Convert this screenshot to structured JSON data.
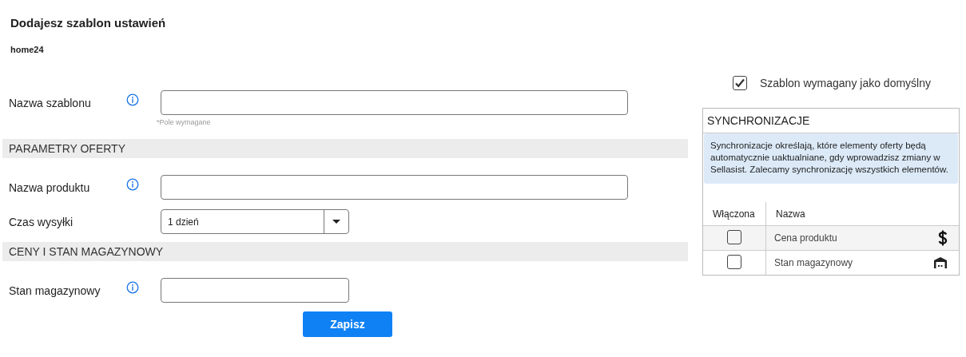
{
  "title": "Dodajesz szablon ustawień",
  "account": "home24",
  "form": [
    {
      "kind": "field",
      "label": "Nazwa szablonu",
      "info": true,
      "hint": "*Pole wymagane"
    },
    {
      "kind": "section",
      "label": "PARAMETRY OFERTY"
    },
    {
      "kind": "field",
      "label": "Nazwa produktu",
      "info": true
    },
    {
      "kind": "select",
      "label": "Czas wysyłki",
      "value": "1 dzień"
    },
    {
      "kind": "section",
      "label": "CENY I STAN MAGAZYNOWY"
    },
    {
      "kind": "short_field",
      "label": "Stan magazynowy",
      "info": true
    }
  ],
  "save_button": "Zapisz",
  "default_checkbox": {
    "label": "Szablon wymagany jako domyślny",
    "checked": true
  },
  "sync": {
    "title": "SYNCHRONIZACJE",
    "info": "Synchronizacje określają, które elementy oferty będą automatycznie uaktualniane, gdy wprowadzisz zmiany w Sellasist. Zalecamy synchronizację wszystkich elementów.",
    "columns": [
      "Włączona",
      "Nazwa"
    ],
    "rows": [
      {
        "name": "Cena produktu",
        "checked": false,
        "kind": "price"
      },
      {
        "name": "Stan magazynowy",
        "checked": false,
        "kind": "stock"
      }
    ]
  }
}
